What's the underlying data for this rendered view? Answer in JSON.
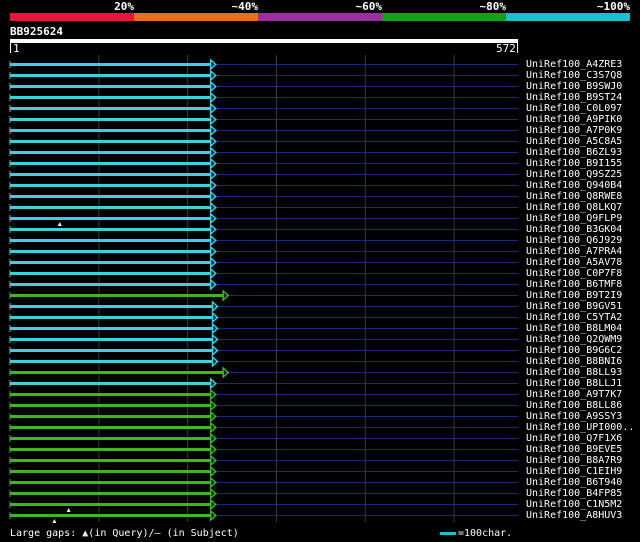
{
  "scale": {
    "labels": [
      "20%",
      "~40%",
      "~60%",
      "~80%",
      "~100%"
    ],
    "colors": [
      "#e8173a",
      "#e8701c",
      "#9b2fa0",
      "#1a9e1a",
      "#18c0d0"
    ]
  },
  "query": {
    "id": "BB925624",
    "start_label": "1",
    "end_label": "572",
    "length": 572
  },
  "colors": {
    "cyan": "#3fd0e0",
    "green": "#3cb81c",
    "track": "#1b2a78",
    "grid": "#3c3c3c",
    "gap_marker": "#fff6b0"
  },
  "hits": [
    {
      "name": "UniRef100_A4ZRE3",
      "color": "cyan",
      "end": 226,
      "gaps": []
    },
    {
      "name": "UniRef100_C3S7Q8",
      "color": "cyan",
      "end": 226,
      "gaps": []
    },
    {
      "name": "UniRef100_B9SWJ0",
      "color": "cyan",
      "end": 226,
      "gaps": []
    },
    {
      "name": "UniRef100_B9ST24",
      "color": "cyan",
      "end": 226,
      "gaps": []
    },
    {
      "name": "UniRef100_C0L097",
      "color": "cyan",
      "end": 226,
      "gaps": []
    },
    {
      "name": "UniRef100_A9PIK0",
      "color": "cyan",
      "end": 226,
      "gaps": []
    },
    {
      "name": "UniRef100_A7P0K9",
      "color": "cyan",
      "end": 226,
      "gaps": []
    },
    {
      "name": "UniRef100_A5C8A5",
      "color": "cyan",
      "end": 226,
      "gaps": []
    },
    {
      "name": "UniRef100_B6ZL93",
      "color": "cyan",
      "end": 226,
      "gaps": []
    },
    {
      "name": "UniRef100_B9I155",
      "color": "cyan",
      "end": 226,
      "gaps": []
    },
    {
      "name": "UniRef100_Q9SZ25",
      "color": "cyan",
      "end": 226,
      "gaps": []
    },
    {
      "name": "UniRef100_Q940B4",
      "color": "cyan",
      "end": 226,
      "gaps": []
    },
    {
      "name": "UniRef100_Q8RWE8",
      "color": "cyan",
      "end": 226,
      "gaps": []
    },
    {
      "name": "UniRef100_Q8LKQ7",
      "color": "cyan",
      "end": 226,
      "gaps": []
    },
    {
      "name": "UniRef100_Q9FLP9",
      "color": "cyan",
      "end": 226,
      "gaps": [
        56
      ]
    },
    {
      "name": "UniRef100_B3GK04",
      "color": "cyan",
      "end": 226,
      "gaps": []
    },
    {
      "name": "UniRef100_Q6J929",
      "color": "cyan",
      "end": 226,
      "gaps": []
    },
    {
      "name": "UniRef100_A7PRA4",
      "color": "cyan",
      "end": 226,
      "gaps": []
    },
    {
      "name": "UniRef100_A5AV78",
      "color": "cyan",
      "end": 226,
      "gaps": []
    },
    {
      "name": "UniRef100_C0P7F8",
      "color": "cyan",
      "end": 226,
      "gaps": []
    },
    {
      "name": "UniRef100_B6TMF8",
      "color": "cyan",
      "end": 226,
      "gaps": []
    },
    {
      "name": "UniRef100_B9T2I9",
      "color": "green",
      "end": 240,
      "gaps": []
    },
    {
      "name": "UniRef100_B9GV51",
      "color": "cyan",
      "end": 228,
      "gaps": []
    },
    {
      "name": "UniRef100_C5YTA2",
      "color": "cyan",
      "end": 228,
      "gaps": []
    },
    {
      "name": "UniRef100_B8LM04",
      "color": "cyan",
      "end": 228,
      "gaps": []
    },
    {
      "name": "UniRef100_Q2QWM9",
      "color": "cyan",
      "end": 228,
      "gaps": []
    },
    {
      "name": "UniRef100_B9G6C2",
      "color": "cyan",
      "end": 228,
      "gaps": []
    },
    {
      "name": "UniRef100_B8BNI6",
      "color": "cyan",
      "end": 228,
      "gaps": []
    },
    {
      "name": "UniRef100_B8LL93",
      "color": "green",
      "end": 240,
      "gaps": []
    },
    {
      "name": "UniRef100_B8LLJ1",
      "color": "cyan",
      "end": 226,
      "gaps": []
    },
    {
      "name": "UniRef100_A9T7K7",
      "color": "green",
      "end": 226,
      "gaps": []
    },
    {
      "name": "UniRef100_B8LL86",
      "color": "green",
      "end": 226,
      "gaps": []
    },
    {
      "name": "UniRef100_A9SSY3",
      "color": "green",
      "end": 226,
      "gaps": []
    },
    {
      "name": "UniRef100_UPI000..",
      "color": "green",
      "end": 226,
      "gaps": []
    },
    {
      "name": "UniRef100_Q7F1X6",
      "color": "green",
      "end": 226,
      "gaps": []
    },
    {
      "name": "UniRef100_B9EVE5",
      "color": "green",
      "end": 226,
      "gaps": []
    },
    {
      "name": "UniRef100_B8A7R9",
      "color": "green",
      "end": 226,
      "gaps": []
    },
    {
      "name": "UniRef100_C1EIH9",
      "color": "green",
      "end": 226,
      "gaps": []
    },
    {
      "name": "UniRef100_B6T940",
      "color": "green",
      "end": 226,
      "gaps": []
    },
    {
      "name": "UniRef100_B4FP85",
      "color": "green",
      "end": 226,
      "gaps": []
    },
    {
      "name": "UniRef100_C1N5M2",
      "color": "green",
      "end": 226,
      "gaps": [
        66
      ]
    },
    {
      "name": "UniRef100_A8HUV3",
      "color": "green",
      "end": 226,
      "gaps": [
        50
      ]
    }
  ],
  "legend": {
    "large_gaps_prefix": "Large gaps:",
    "query_gap_symbol": "▲",
    "query_gap_text": "(in Query)/",
    "subject_gap_symbol": "—",
    "subject_gap_text": " (in Subject)",
    "scale_text": "=100char."
  }
}
